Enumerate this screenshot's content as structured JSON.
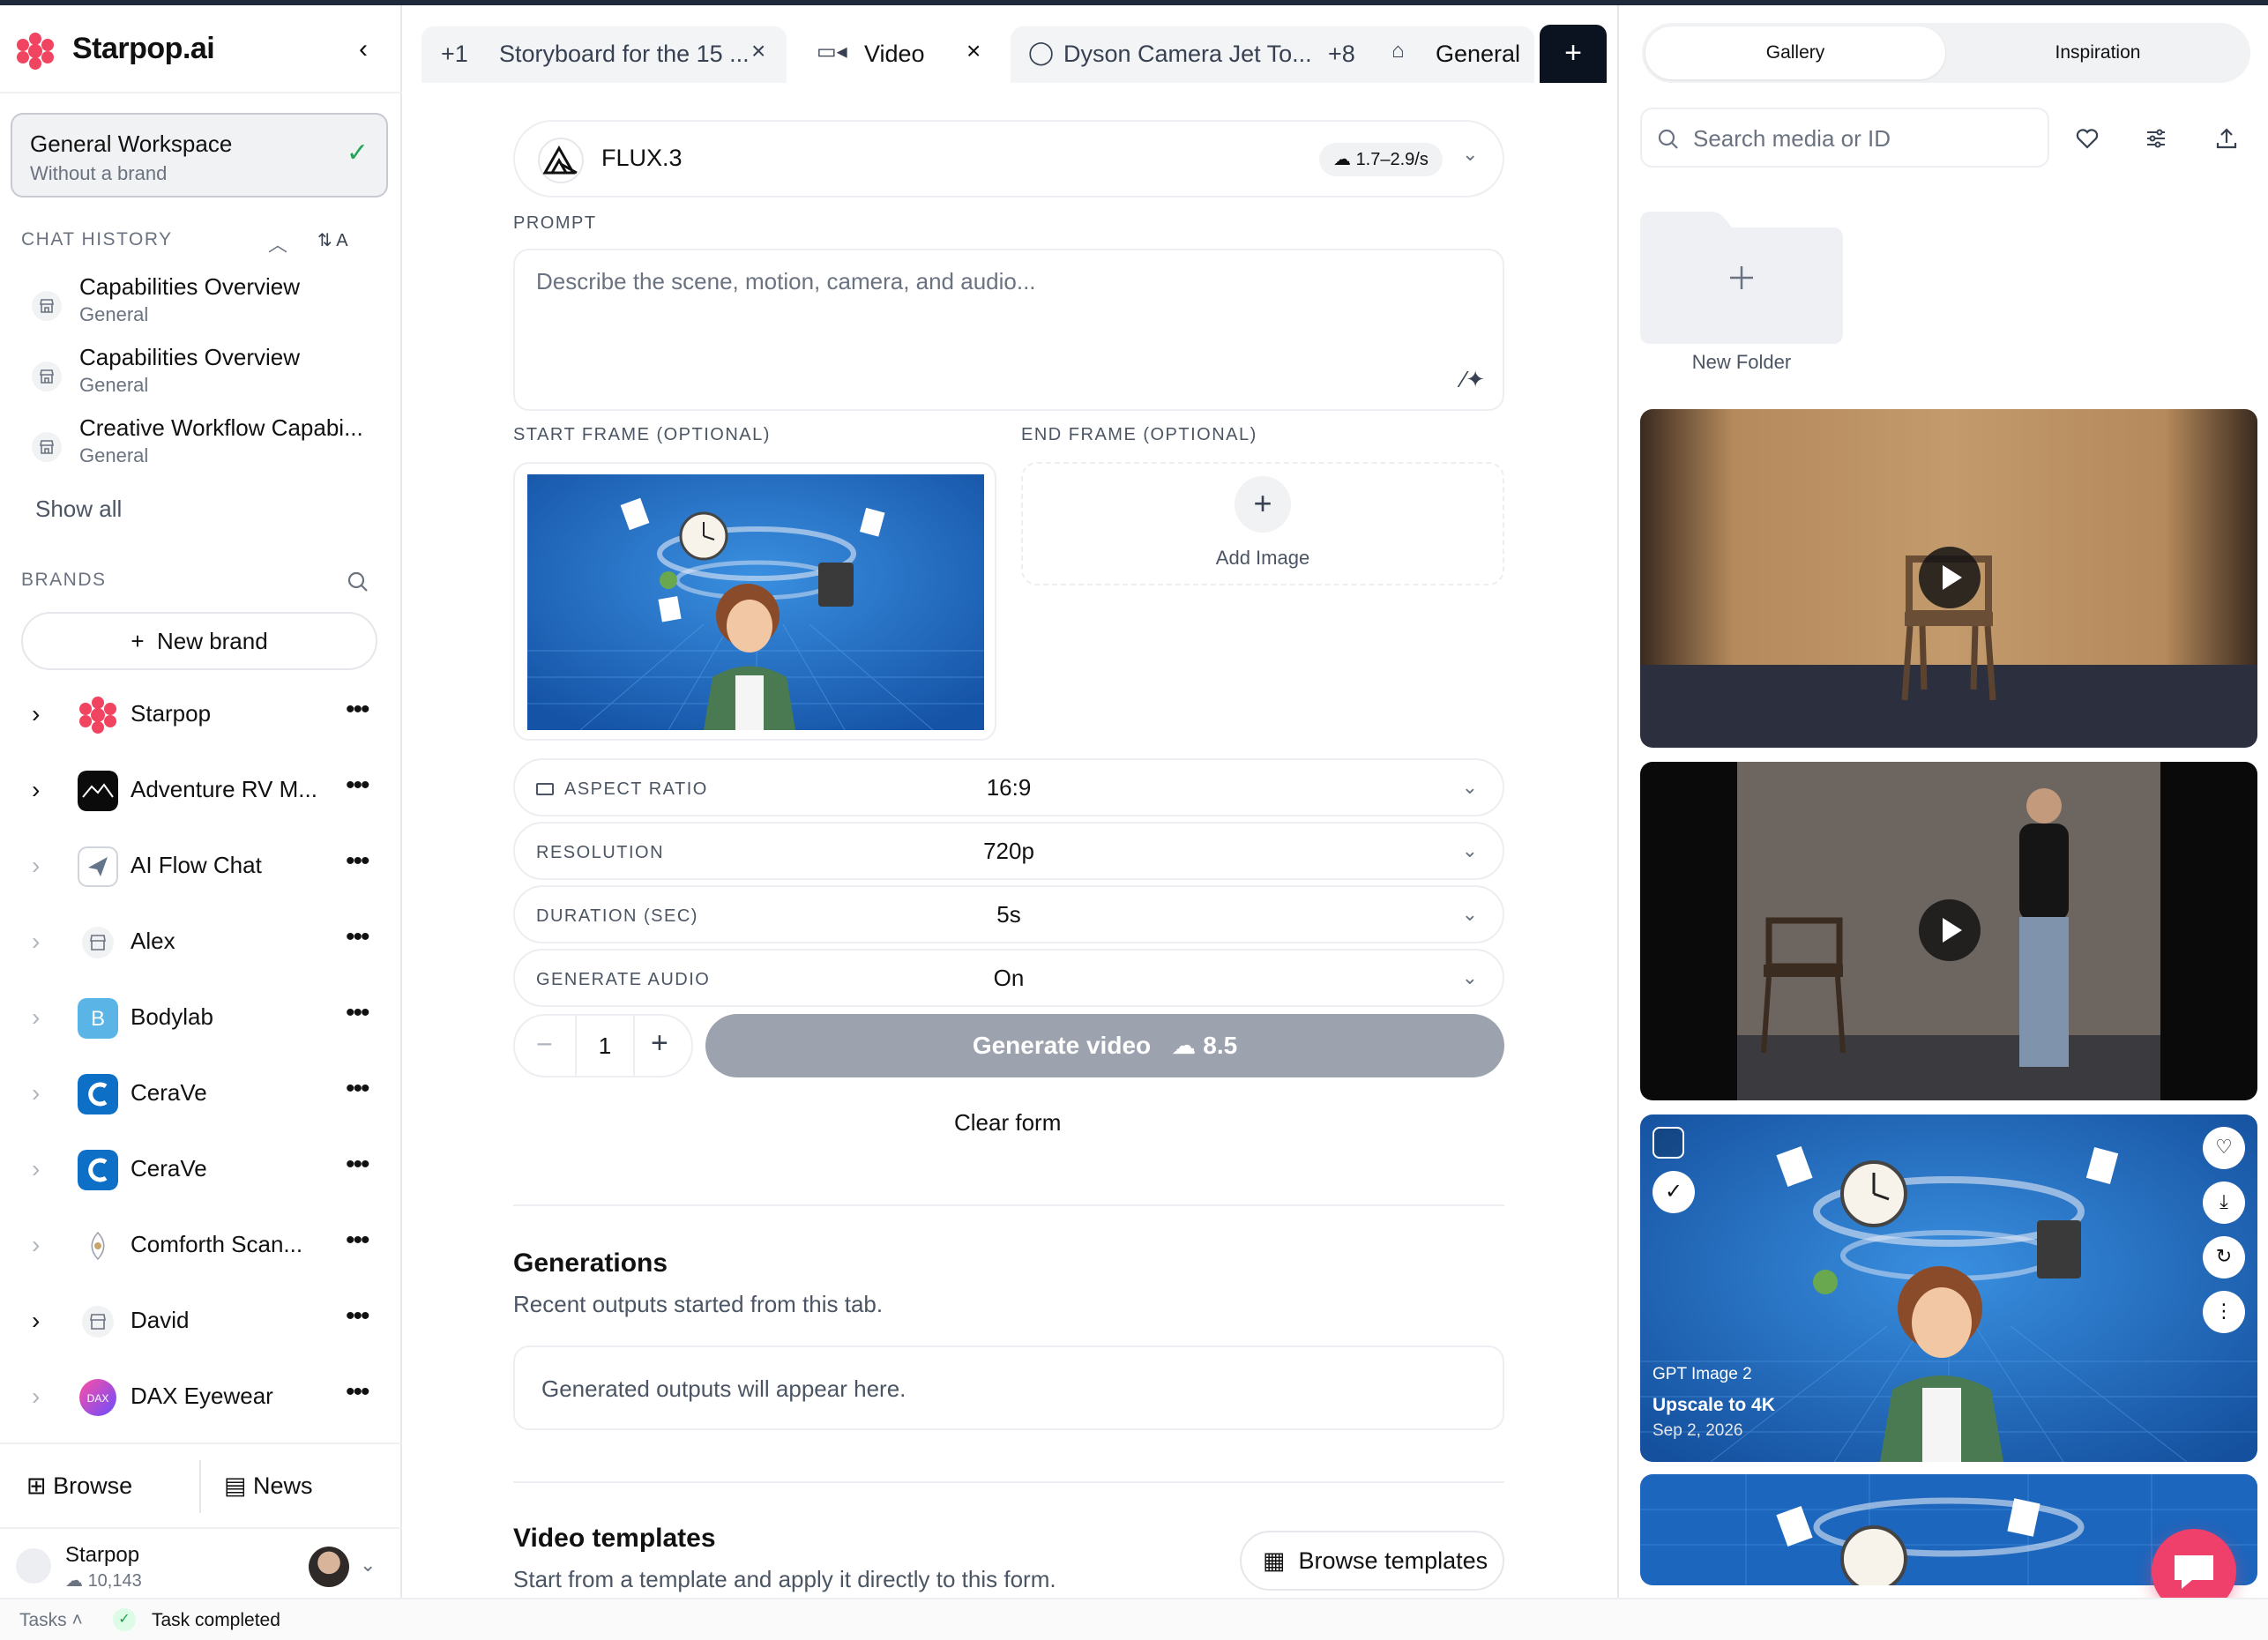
{
  "app": {
    "name": "Starpop.ai"
  },
  "workspace": {
    "title": "General Workspace",
    "subtitle": "Without a brand"
  },
  "chat_history": {
    "label": "CHAT HISTORY",
    "sort_label": "A",
    "items": [
      {
        "title": "Capabilities Overview",
        "sub": "General"
      },
      {
        "title": "Capabilities Overview",
        "sub": "General"
      },
      {
        "title": "Creative Workflow Capabi...",
        "sub": "General"
      }
    ],
    "show_all": "Show all"
  },
  "brands": {
    "label": "BRANDS",
    "new_brand": "New brand",
    "items": [
      {
        "name": "Starpop",
        "logo": "starpop-logo"
      },
      {
        "name": "Adventure RV M...",
        "logo": "mountain-logo"
      },
      {
        "name": "AI Flow Chat",
        "logo": "paper-plane-logo"
      },
      {
        "name": "Alex",
        "logo": "store-icon"
      },
      {
        "name": "Bodylab",
        "logo": "b-letter-logo"
      },
      {
        "name": "CeraVe",
        "logo": "cerave-logo"
      },
      {
        "name": "CeraVe",
        "logo": "cerave-logo"
      },
      {
        "name": "Comforth Scan...",
        "logo": "comforth-logo"
      },
      {
        "name": "David",
        "logo": "store-icon"
      },
      {
        "name": "DAX Eyewear",
        "logo": "dax-logo"
      }
    ]
  },
  "bottom_nav": {
    "browse": "Browse",
    "news": "News"
  },
  "user": {
    "name": "Starpop",
    "credits": "10,143"
  },
  "status_bar": {
    "tasks": "Tasks",
    "status": "Task completed"
  },
  "tabs": [
    {
      "count": "+1",
      "label": "Storyboard for the 15 ..."
    },
    {
      "label": "Video",
      "active": true
    },
    {
      "label": "Dyson Camera Jet To...",
      "more": "+8"
    },
    {
      "label": "General"
    }
  ],
  "form": {
    "model": {
      "name": "FLUX.3",
      "rate": "1.7–2.9/s"
    },
    "prompt": {
      "label": "PROMPT",
      "placeholder": "Describe the scene, motion, camera, and audio..."
    },
    "start_frame": {
      "label": "START FRAME (OPTIONAL)"
    },
    "end_frame": {
      "label": "END FRAME (OPTIONAL)",
      "add": "Add Image"
    },
    "options": [
      {
        "label": "ASPECT RATIO",
        "value": "16:9"
      },
      {
        "label": "RESOLUTION",
        "value": "720p"
      },
      {
        "label": "DURATION (SEC)",
        "value": "5s"
      },
      {
        "label": "GENERATE AUDIO",
        "value": "On"
      }
    ],
    "quantity": "1",
    "generate": {
      "label": "Generate video",
      "cost": "8.5"
    },
    "clear": "Clear form"
  },
  "generations": {
    "title": "Generations",
    "subtitle": "Recent outputs started from this tab.",
    "empty": "Generated outputs will appear here."
  },
  "templates": {
    "title": "Video templates",
    "subtitle": "Start from a template and apply it directly to this form.",
    "button": "Browse templates"
  },
  "gallery": {
    "tabs": {
      "gallery": "Gallery",
      "inspiration": "Inspiration"
    },
    "search_placeholder": "Search media or ID",
    "new_folder": "New Folder",
    "card3": {
      "model": "GPT Image 2",
      "action": "Upscale to 4K",
      "date": "Sep 2, 2026"
    }
  }
}
